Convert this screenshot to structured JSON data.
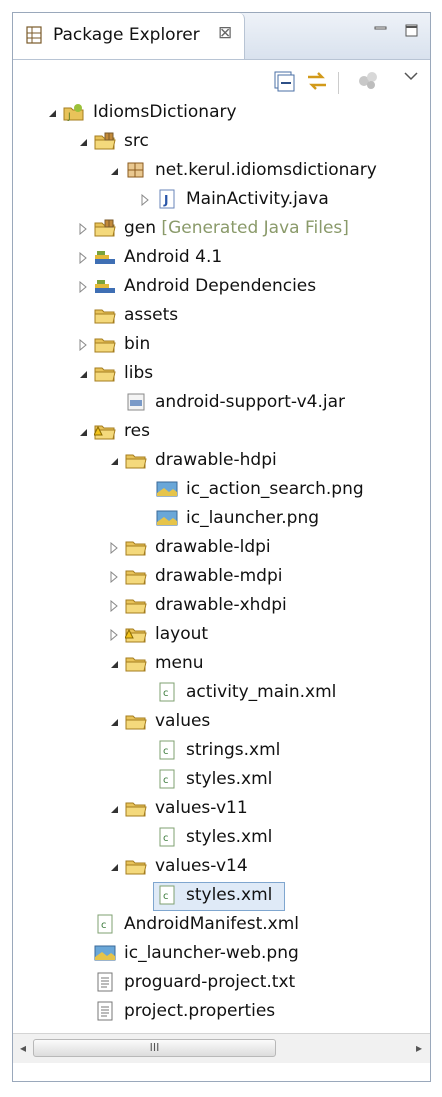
{
  "view": {
    "tab_title": "Package Explorer",
    "tab_close_glyph": "⊠",
    "window_buttons": [
      "minimize-icon",
      "maximize-icon"
    ],
    "toolbar_icons": [
      "collapse-all-icon",
      "link-with-editor-icon",
      "focus-on-active-task-icon",
      "view-menu-icon"
    ]
  },
  "tree": [
    {
      "label": "IdiomsDictionary",
      "icon": "android-project-icon",
      "expand": "expanded",
      "depth": 0
    },
    {
      "label": "src",
      "icon": "source-folder-icon",
      "expand": "expanded",
      "depth": 1
    },
    {
      "label": "net.kerul.idiomsdictionary",
      "icon": "package-icon",
      "expand": "expanded",
      "depth": 2
    },
    {
      "label": "MainActivity.java",
      "icon": "java-file-icon",
      "expand": "collapsed",
      "depth": 3
    },
    {
      "label": "gen",
      "decor": " [Generated Java Files]",
      "icon": "source-folder-icon",
      "expand": "collapsed",
      "depth": 1
    },
    {
      "label": "Android 4.1",
      "icon": "library-icon",
      "expand": "collapsed",
      "depth": 1
    },
    {
      "label": "Android Dependencies",
      "icon": "library-icon",
      "expand": "collapsed",
      "depth": 1
    },
    {
      "label": "assets",
      "icon": "folder-icon",
      "expand": "none",
      "depth": 1
    },
    {
      "label": "bin",
      "icon": "folder-icon",
      "expand": "collapsed",
      "depth": 1
    },
    {
      "label": "libs",
      "icon": "folder-icon",
      "expand": "expanded",
      "depth": 1
    },
    {
      "label": "android-support-v4.jar",
      "icon": "jar-file-icon",
      "expand": "none",
      "depth": 2
    },
    {
      "label": "res",
      "icon": "warning-folder-icon",
      "expand": "expanded",
      "depth": 1
    },
    {
      "label": "drawable-hdpi",
      "icon": "folder-icon",
      "expand": "expanded",
      "depth": 2
    },
    {
      "label": "ic_action_search.png",
      "icon": "image-file-icon",
      "expand": "none",
      "depth": 3
    },
    {
      "label": "ic_launcher.png",
      "icon": "image-file-icon",
      "expand": "none",
      "depth": 3
    },
    {
      "label": "drawable-ldpi",
      "icon": "folder-icon",
      "expand": "collapsed",
      "depth": 2
    },
    {
      "label": "drawable-mdpi",
      "icon": "folder-icon",
      "expand": "collapsed",
      "depth": 2
    },
    {
      "label": "drawable-xhdpi",
      "icon": "folder-icon",
      "expand": "collapsed",
      "depth": 2
    },
    {
      "label": "layout",
      "icon": "warning-folder-icon",
      "expand": "collapsed",
      "depth": 2
    },
    {
      "label": "menu",
      "icon": "folder-icon",
      "expand": "expanded",
      "depth": 2
    },
    {
      "label": "activity_main.xml",
      "icon": "xml-file-icon",
      "expand": "none",
      "depth": 3
    },
    {
      "label": "values",
      "icon": "folder-icon",
      "expand": "expanded",
      "depth": 2
    },
    {
      "label": "strings.xml",
      "icon": "xml-file-icon",
      "expand": "none",
      "depth": 3
    },
    {
      "label": "styles.xml",
      "icon": "xml-file-icon",
      "expand": "none",
      "depth": 3
    },
    {
      "label": "values-v11",
      "icon": "folder-icon",
      "expand": "expanded",
      "depth": 2
    },
    {
      "label": "styles.xml",
      "icon": "xml-file-icon",
      "expand": "none",
      "depth": 3
    },
    {
      "label": "values-v14",
      "icon": "folder-icon",
      "expand": "expanded",
      "depth": 2
    },
    {
      "label": "styles.xml",
      "icon": "xml-file-icon",
      "expand": "none",
      "depth": 3,
      "selected": true
    },
    {
      "label": "AndroidManifest.xml",
      "icon": "xml-file-icon",
      "expand": "none",
      "depth": 1
    },
    {
      "label": "ic_launcher-web.png",
      "icon": "image-file-icon",
      "expand": "none",
      "depth": 1
    },
    {
      "label": "proguard-project.txt",
      "icon": "text-file-icon",
      "expand": "none",
      "depth": 1
    },
    {
      "label": "project.properties",
      "icon": "text-file-icon",
      "expand": "none",
      "depth": 1
    }
  ],
  "scrollbar": {
    "left_arrow": "◂",
    "right_arrow": "▸",
    "thumb_grip": "III"
  },
  "colors": {
    "selection": "#dfeaf7",
    "selection_border": "#7fa6cf",
    "decoration": "#8a9a6a",
    "folder": "#e8c35a"
  }
}
